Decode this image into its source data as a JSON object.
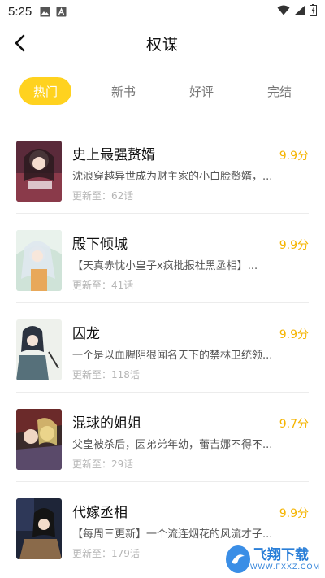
{
  "status_bar": {
    "time": "5:25"
  },
  "header": {
    "title": "权谋"
  },
  "tabs": [
    {
      "label": "热门",
      "active": true
    },
    {
      "label": "新书",
      "active": false
    },
    {
      "label": "好评",
      "active": false
    },
    {
      "label": "完结",
      "active": false
    }
  ],
  "books": [
    {
      "title": "史上最强赘婿",
      "desc": "沈浪穿越异世成为财主家的小白脸赘婿，...",
      "update": "更新至：62话",
      "score": "9.9分"
    },
    {
      "title": "殿下倾城",
      "desc": "【天真赤忱小皇子x疯批报社黑丞相】...",
      "update": "更新至：41话",
      "score": "9.9分"
    },
    {
      "title": "囚龙",
      "desc": "一个是以血腥阴狠闻名天下的禁林卫统领...",
      "update": "更新至：118话",
      "score": "9.9分"
    },
    {
      "title": "混球的姐姐",
      "desc": "父皇被杀后，因弟弟年幼，蕾吉娜不得不...",
      "update": "更新至：29话",
      "score": "9.7分"
    },
    {
      "title": "代嫁丞相",
      "desc": "【每周三更新】一个流连烟花的风流才子...",
      "update": "更新至：179话",
      "score": "9.9分"
    }
  ],
  "watermark": {
    "text": "飞翔下载",
    "sub": "WWW.FXXZ.COM"
  },
  "colors": {
    "accent": "#ffd21f",
    "score": "#f5b400"
  }
}
